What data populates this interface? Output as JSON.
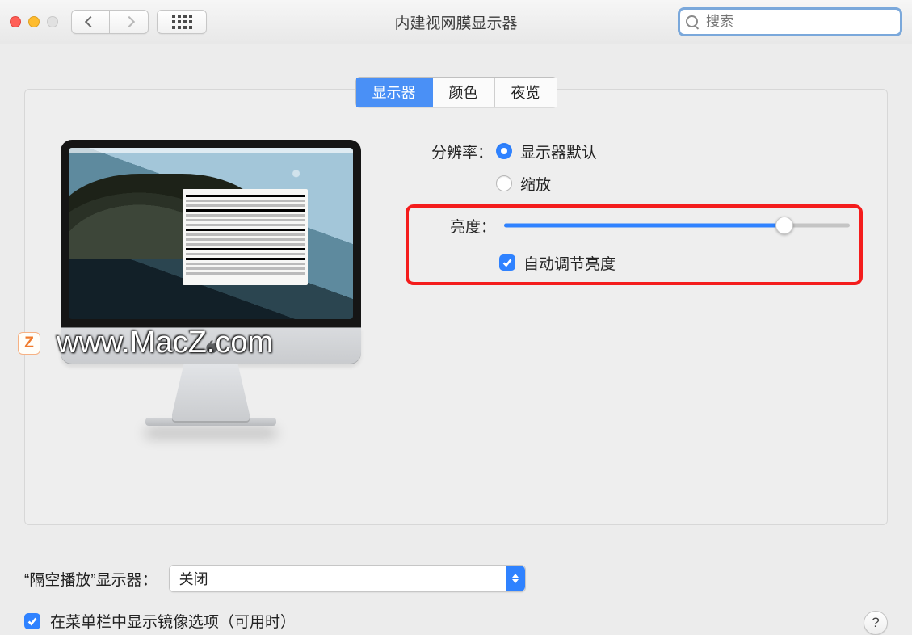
{
  "window": {
    "title": "内建视网膜显示器"
  },
  "search": {
    "placeholder": "搜索"
  },
  "tabs": {
    "display": "显示器",
    "color": "颜色",
    "night": "夜览"
  },
  "settings": {
    "resolution_label": "分辨率：",
    "res_default": "显示器默认",
    "res_scaled": "缩放",
    "brightness_label": "亮度：",
    "brightness_value": 81,
    "auto_brightness": "自动调节亮度"
  },
  "airplay": {
    "label": "“隔空播放”显示器：",
    "value": "关闭"
  },
  "mirror": {
    "label": "在菜单栏中显示镜像选项（可用时）"
  },
  "help": "?",
  "watermark": {
    "badge": "Z",
    "text": "www.MacZ.com"
  }
}
